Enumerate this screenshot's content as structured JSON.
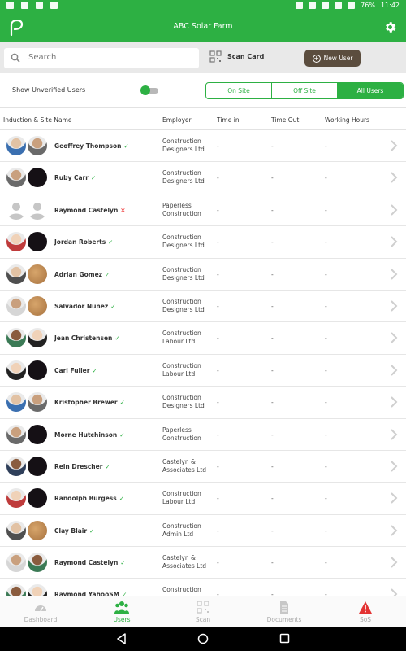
{
  "status_bar": {
    "battery": "76%",
    "time": "11:42"
  },
  "app_bar": {
    "title": "ABC Solar Farm",
    "logo_icon": "leaf-logo-icon",
    "settings_icon": "gear-icon"
  },
  "search": {
    "placeholder": "Search",
    "scan_label": "Scan Card",
    "new_user_label": "New User"
  },
  "filters": {
    "unverified_label": "Show Unverified Users",
    "unverified_on": true,
    "segments": [
      "On Site",
      "Off Site",
      "All Users"
    ],
    "selected_segment": "All Users"
  },
  "table": {
    "headers": [
      "Induction & Site Name",
      "Employer",
      "Time in",
      "Time Out",
      "Working Hours"
    ],
    "rows": [
      {
        "name": "Geoffrey  Thompson",
        "verified": true,
        "employer": "Construction Designers Ltd",
        "time_in": "-",
        "time_out": "-",
        "hours": "-",
        "avatars": [
          "photo",
          "photo"
        ]
      },
      {
        "name": "Ruby  Carr",
        "verified": true,
        "employer": "Construction Designers Ltd",
        "time_in": "-",
        "time_out": "-",
        "hours": "-",
        "avatars": [
          "photo",
          "dark"
        ]
      },
      {
        "name": "Raymond Castelyn",
        "verified": false,
        "employer": "Paperless Construction",
        "time_in": "-",
        "time_out": "-",
        "hours": "-",
        "avatars": [
          "gray",
          "gray"
        ]
      },
      {
        "name": "Jordan  Roberts",
        "verified": true,
        "employer": "Construction Designers Ltd",
        "time_in": "-",
        "time_out": "-",
        "hours": "-",
        "avatars": [
          "photo",
          "dark"
        ]
      },
      {
        "name": "Adrian  Gomez",
        "verified": true,
        "employer": "Construction Designers Ltd",
        "time_in": "-",
        "time_out": "-",
        "hours": "-",
        "avatars": [
          "photo",
          "wood"
        ]
      },
      {
        "name": "Salvador  Nunez",
        "verified": true,
        "employer": "Construction Designers Ltd",
        "time_in": "-",
        "time_out": "-",
        "hours": "-",
        "avatars": [
          "photo",
          "wood"
        ]
      },
      {
        "name": "Jean  Christensen",
        "verified": true,
        "employer": "Construction Labour Ltd",
        "time_in": "-",
        "time_out": "-",
        "hours": "-",
        "avatars": [
          "photo",
          "photo"
        ]
      },
      {
        "name": "Carl  Fuller",
        "verified": true,
        "employer": "Construction Labour Ltd",
        "time_in": "-",
        "time_out": "-",
        "hours": "-",
        "avatars": [
          "photo",
          "dark"
        ]
      },
      {
        "name": "Kristopher Brewer",
        "verified": true,
        "employer": "Construction Designers Ltd",
        "time_in": "-",
        "time_out": "-",
        "hours": "-",
        "avatars": [
          "photo",
          "photo"
        ]
      },
      {
        "name": "Morne Hutchinson",
        "verified": true,
        "employer": "Paperless Construction",
        "time_in": "-",
        "time_out": "-",
        "hours": "-",
        "avatars": [
          "photo",
          "dark"
        ]
      },
      {
        "name": "Rein Drescher",
        "verified": true,
        "employer": "Castelyn & Associates Ltd",
        "time_in": "-",
        "time_out": "-",
        "hours": "-",
        "avatars": [
          "photo",
          "dark"
        ]
      },
      {
        "name": "Randolph  Burgess",
        "verified": true,
        "employer": "Construction Labour Ltd",
        "time_in": "-",
        "time_out": "-",
        "hours": "-",
        "avatars": [
          "photo",
          "dark"
        ]
      },
      {
        "name": "Clay  Blair",
        "verified": true,
        "employer": "Construction Admin Ltd",
        "time_in": "-",
        "time_out": "-",
        "hours": "-",
        "avatars": [
          "photo",
          "wood"
        ]
      },
      {
        "name": "Raymond Castelyn",
        "verified": true,
        "employer": "Castelyn & Associates Ltd",
        "time_in": "-",
        "time_out": "-",
        "hours": "-",
        "avatars": [
          "photo",
          "photo"
        ]
      },
      {
        "name": "Raymond YahooSM",
        "verified": true,
        "employer": "Construction",
        "time_in": "-",
        "time_out": "-",
        "hours": "-",
        "avatars": [
          "photo",
          "photo"
        ]
      }
    ]
  },
  "tabs": [
    {
      "label": "Dashboard",
      "icon": "dashboard-icon",
      "active": false
    },
    {
      "label": "Users",
      "icon": "users-icon",
      "active": true
    },
    {
      "label": "Scan",
      "icon": "qr-scan-icon",
      "active": false
    },
    {
      "label": "Documents",
      "icon": "document-icon",
      "active": false
    },
    {
      "label": "SoS",
      "icon": "warning-icon",
      "active": false
    }
  ],
  "colors": {
    "primary": "#2db043",
    "new_user_button": "#5b4d3e",
    "sos": "#e33333",
    "unverified_mark": "#e33333"
  }
}
